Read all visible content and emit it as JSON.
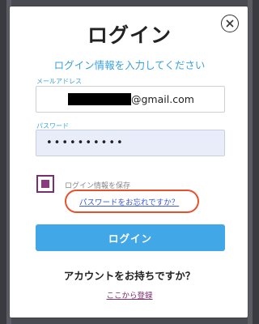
{
  "dialog": {
    "title": "ログイン",
    "subtitle": "ログイン情報を入力してください"
  },
  "email": {
    "label": "メールアドレス",
    "visible_suffix": "@gmail.com"
  },
  "password": {
    "label": "パスワード",
    "masked_value": "••••••••••"
  },
  "remember": {
    "label": "ログイン情報を保存",
    "checked": true
  },
  "forgot": {
    "label": "パスワードをお忘れですか？"
  },
  "login_button": {
    "label": "ログイン"
  },
  "signup": {
    "prompt": "アカウントをお持ちですか？",
    "link": "ここから登録"
  },
  "colors": {
    "accent": "#41a7e6",
    "brand_purple": "#7a2e6e",
    "highlight": "#e8502a",
    "link": "#3b5bdb"
  },
  "icons": {
    "close": "close-icon"
  }
}
